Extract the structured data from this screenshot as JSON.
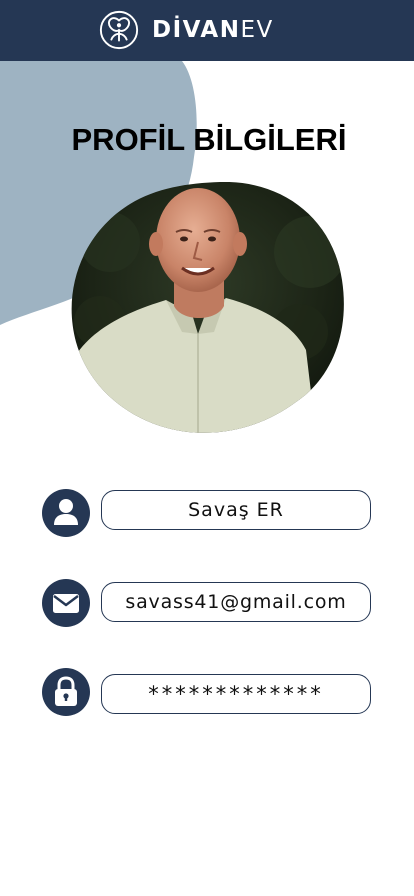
{
  "header": {
    "brand_strong": "DİVAN",
    "brand_light": "EV",
    "logo_icon": "tree-heart-icon",
    "background": "#253754"
  },
  "page": {
    "title": "PROFİL BİLGİLERİ"
  },
  "profile": {
    "avatar_icon": "profile-photo"
  },
  "fields": {
    "name": {
      "icon": "user-icon",
      "value": "Savaş ER"
    },
    "email": {
      "icon": "envelope-icon",
      "value": "savass41@gmail.com"
    },
    "password": {
      "icon": "lock-icon",
      "value": "*************"
    }
  },
  "colors": {
    "primary": "#253754",
    "accent_blob": "#9EB3C2",
    "background": "#ffffff"
  }
}
